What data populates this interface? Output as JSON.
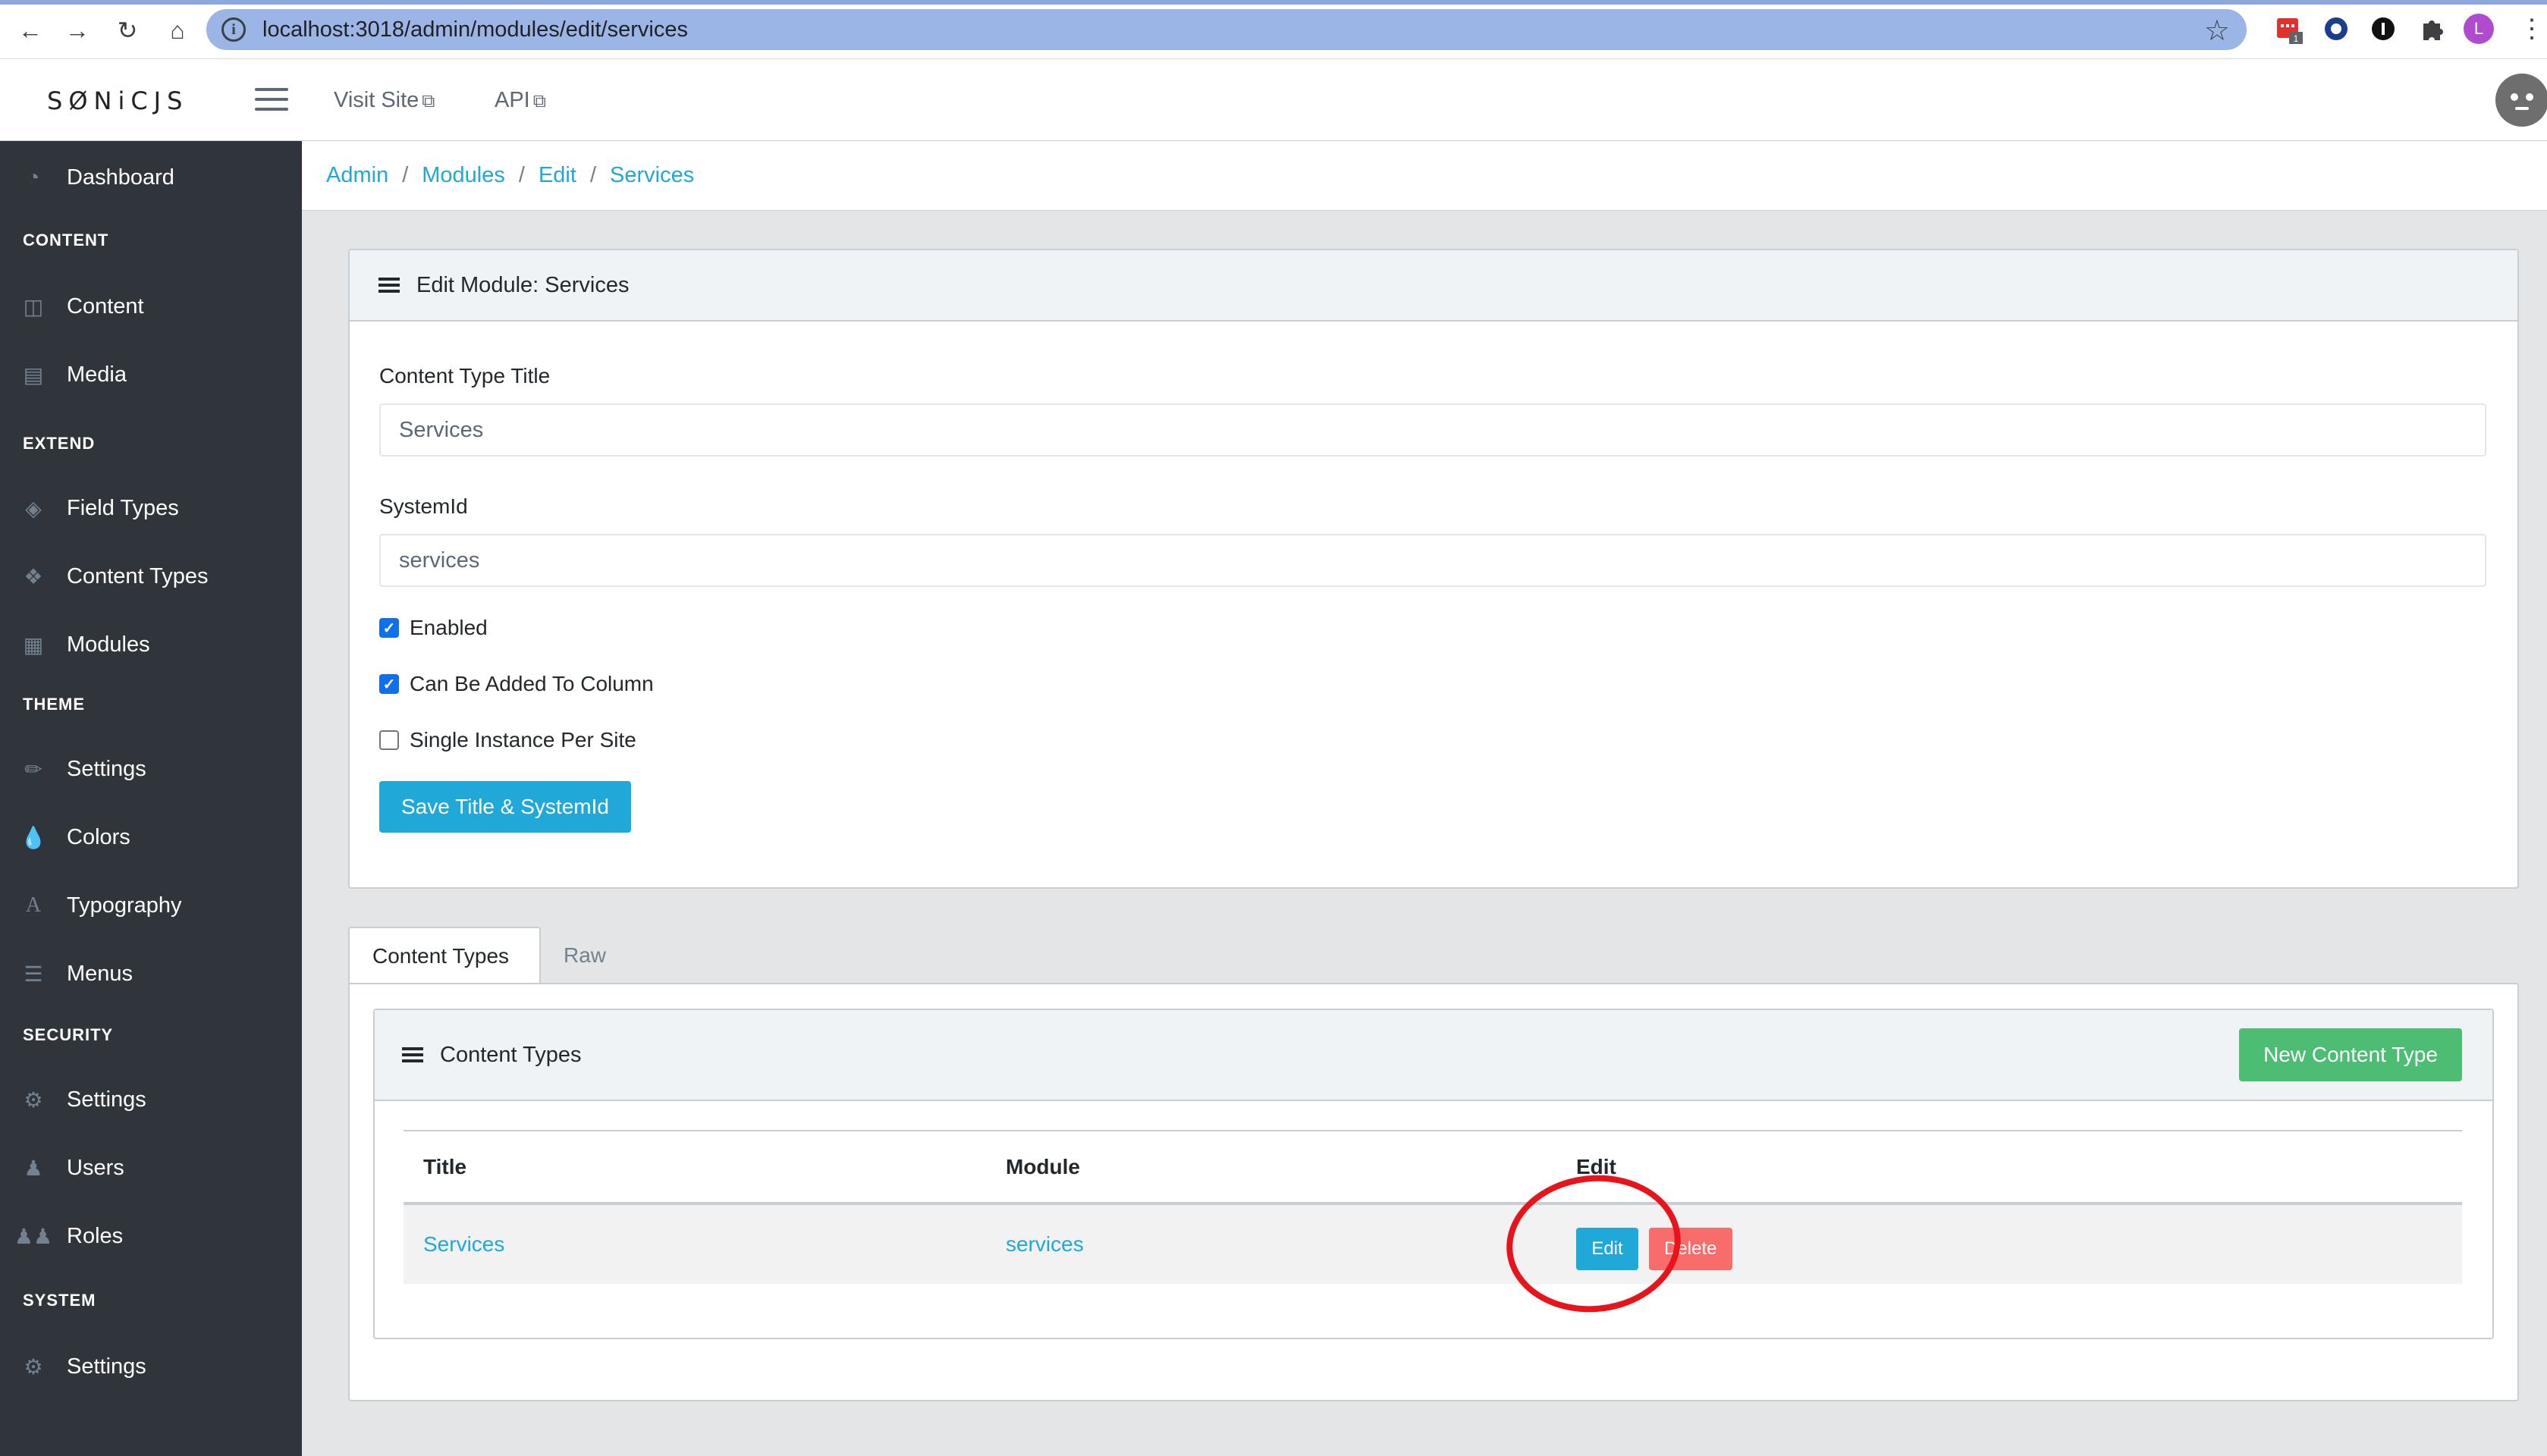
{
  "browser": {
    "url": "localhost:3018/admin/modules/edit/services",
    "profile_initial": "L",
    "ext_badge": "1"
  },
  "header": {
    "logo": "SØNiCJS",
    "links": [
      {
        "label": "Visit Site"
      },
      {
        "label": "API"
      }
    ]
  },
  "sidebar": {
    "dashboard": "Dashboard",
    "sections": [
      {
        "title": "CONTENT",
        "items": [
          "Content",
          "Media"
        ]
      },
      {
        "title": "EXTEND",
        "items": [
          "Field Types",
          "Content Types",
          "Modules"
        ]
      },
      {
        "title": "THEME",
        "items": [
          "Settings",
          "Colors",
          "Typography",
          "Menus"
        ]
      },
      {
        "title": "SECURITY",
        "items": [
          "Settings",
          "Users",
          "Roles"
        ]
      },
      {
        "title": "SYSTEM",
        "items": [
          "Settings"
        ]
      }
    ]
  },
  "breadcrumb": [
    "Admin",
    "Modules",
    "Edit",
    "Services"
  ],
  "edit_card": {
    "title": "Edit Module: Services",
    "content_type_title_label": "Content Type Title",
    "content_type_title_value": "Services",
    "system_id_label": "SystemId",
    "system_id_value": "services",
    "checkboxes": [
      {
        "label": "Enabled",
        "checked": true
      },
      {
        "label": "Can Be Added To Column",
        "checked": true
      },
      {
        "label": "Single Instance Per Site",
        "checked": false
      }
    ],
    "save_button": "Save Title & SystemId"
  },
  "tabs": [
    "Content Types",
    "Raw"
  ],
  "content_types_card": {
    "title": "Content Types",
    "new_button": "New Content Type",
    "columns": [
      "Title",
      "Module",
      "Edit"
    ],
    "rows": [
      {
        "title": "Services",
        "module": "services",
        "edit": "Edit",
        "delete": "Delete"
      }
    ]
  },
  "colors": {
    "primary": "#20a8d8",
    "success": "#4dbd74",
    "danger": "#f86c6b",
    "sidebar": "#2f353a",
    "annotation": "#e8141b"
  }
}
